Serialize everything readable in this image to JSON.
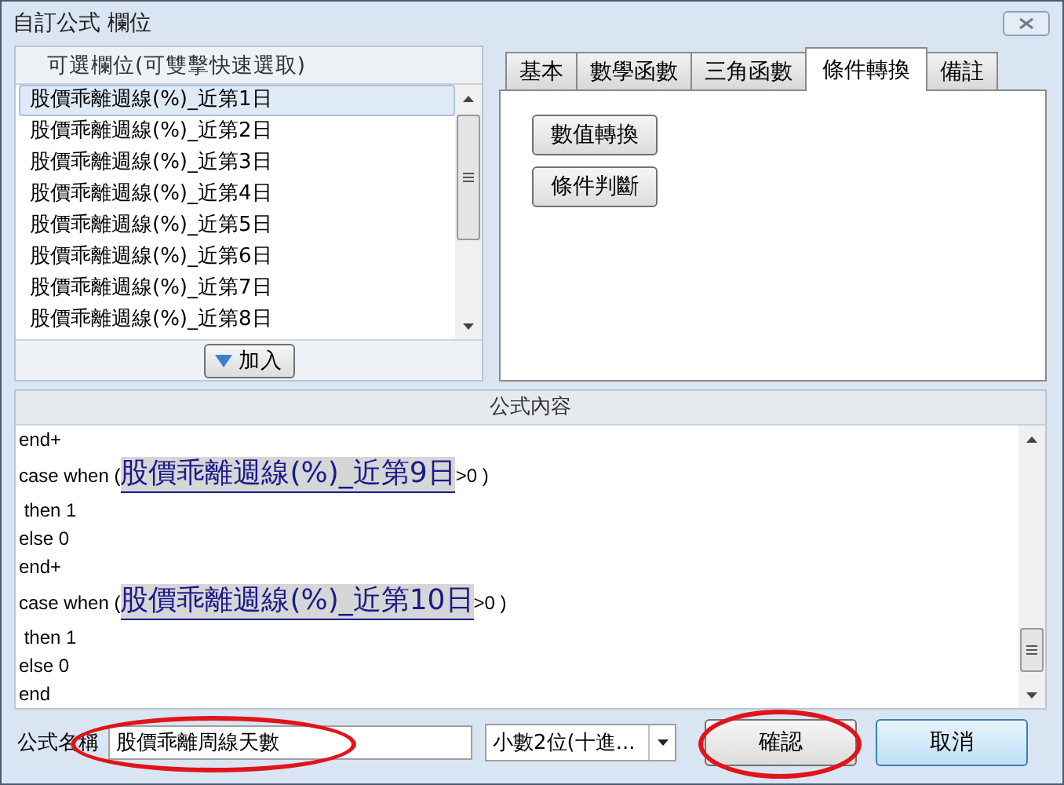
{
  "window": {
    "title": "自訂公式 欄位"
  },
  "fields_panel": {
    "header": "可選欄位(可雙擊快速選取)",
    "items": [
      {
        "label": "股價乖離週線(%)_近第1日",
        "selected": true
      },
      {
        "label": "股價乖離週線(%)_近第2日",
        "selected": false
      },
      {
        "label": "股價乖離週線(%)_近第3日",
        "selected": false
      },
      {
        "label": "股價乖離週線(%)_近第4日",
        "selected": false
      },
      {
        "label": "股價乖離週線(%)_近第5日",
        "selected": false
      },
      {
        "label": "股價乖離週線(%)_近第6日",
        "selected": false
      },
      {
        "label": "股價乖離週線(%)_近第7日",
        "selected": false
      },
      {
        "label": "股價乖離週線(%)_近第8日",
        "selected": false
      }
    ],
    "add_button": "加入"
  },
  "tabs": [
    {
      "label": "基本",
      "selected": false
    },
    {
      "label": "數學函數",
      "selected": false
    },
    {
      "label": "三角函數",
      "selected": false
    },
    {
      "label": "條件轉換",
      "selected": true
    },
    {
      "label": "備註",
      "selected": false
    }
  ],
  "tab_buttons": [
    "數值轉換",
    "條件判斷"
  ],
  "formula": {
    "header": "公式內容",
    "lines": [
      {
        "kind": "text",
        "text": "end+"
      },
      {
        "kind": "case",
        "prefix": "case when (",
        "field": "股價乖離週線(%)_近第9日",
        "suffix": ">0 )"
      },
      {
        "kind": "text",
        "text": " then 1"
      },
      {
        "kind": "text",
        "text": "else 0"
      },
      {
        "kind": "text",
        "text": "end+"
      },
      {
        "kind": "case",
        "prefix": "case when (",
        "field": "股價乖離週線(%)_近第10日",
        "suffix": ">0 )"
      },
      {
        "kind": "text",
        "text": " then 1"
      },
      {
        "kind": "text",
        "text": "else 0"
      },
      {
        "kind": "text",
        "text": "end"
      }
    ]
  },
  "name_field": {
    "label": "公式名稱",
    "value": "股價乖離周線天數",
    "circled": true
  },
  "decimal_select": {
    "value": "小數2位(十進..."
  },
  "buttons": [
    {
      "label": "確認",
      "kind": "confirm",
      "circled": true
    },
    {
      "label": "取消",
      "kind": "cancel",
      "circled": false
    }
  ]
}
